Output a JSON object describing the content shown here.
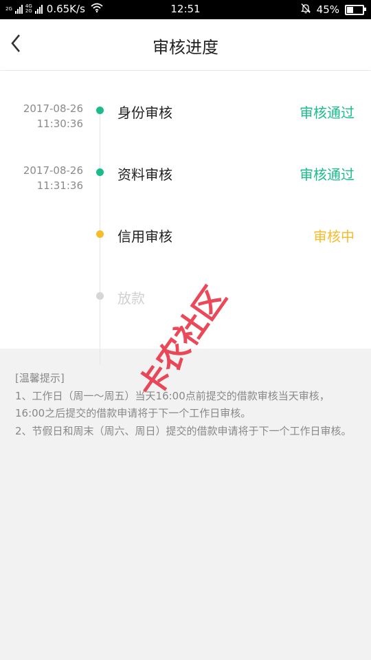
{
  "statusbar": {
    "net_top": "2G",
    "net2_top": "4G",
    "net2_bottom": "2G",
    "speed": "0.65K/s",
    "time": "12:51",
    "battery": "45%",
    "battery_level": 0.45
  },
  "header": {
    "title": "审核进度"
  },
  "steps": [
    {
      "date": "2017-08-26",
      "time": "11:30:36",
      "name": "身份审核",
      "status": "审核通过"
    },
    {
      "date": "2017-08-26",
      "time": "11:31:36",
      "name": "资料审核",
      "status": "审核通过"
    },
    {
      "date": "",
      "time": "",
      "name": "信用审核",
      "status": "审核中"
    },
    {
      "date": "",
      "time": "",
      "name": "放款",
      "status": ""
    }
  ],
  "notice": {
    "title": "[温馨提示]",
    "lines": [
      "1、工作日（周一～周五）当天16:00点前提交的借款审核当天审核，16:00之后提交的借款申请将于下一个工作日审核。",
      "2、节假日和周末（周六、周日）提交的借款申请将于下一个工作日审核。"
    ]
  },
  "watermark": {
    "text": "卡农社区"
  },
  "colors": {
    "green": "#1abc8c",
    "yellow": "#f5bc2c",
    "gray": "#cccccc",
    "watermark": "#e8283c"
  }
}
